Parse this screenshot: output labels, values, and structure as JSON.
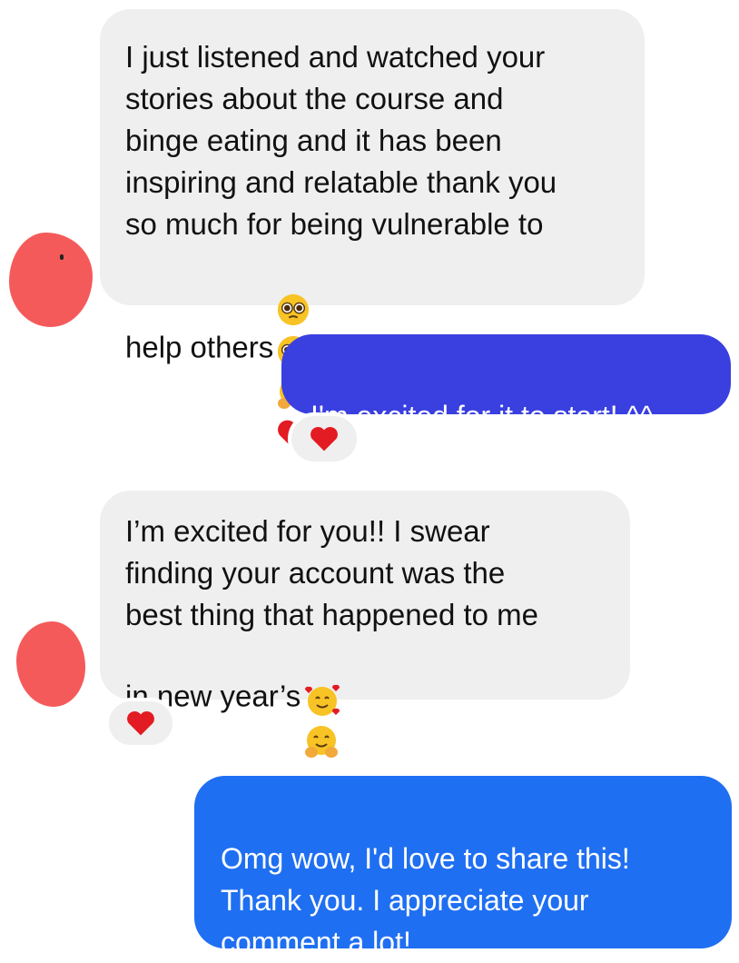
{
  "conversation": {
    "messages": [
      {
        "id": "msg1",
        "direction": "incoming",
        "text": "I just listened and watched your\nstories about the course and\nbinge eating and it has been\ninspiring and relatable thank you\nso much for being vulnerable to\nhelp others",
        "emojis": [
          "pleading-face",
          "pleading-face",
          "hugging-face",
          "red-heart"
        ]
      },
      {
        "id": "msg2",
        "direction": "outgoing",
        "text": "I'm excited for it to start! ^^",
        "reaction": "red-heart"
      },
      {
        "id": "msg3",
        "direction": "incoming",
        "text": "I’m excited for you!! I swear\nfinding your account was the\nbest thing that happened to me\nin new year’s",
        "emojis": [
          "smiling-face-with-hearts",
          "hugging-face"
        ],
        "reaction": "red-heart"
      },
      {
        "id": "msg4",
        "direction": "outgoing",
        "text": "Omg wow, I'd love to share this!\nThank you. I appreciate your\ncomment a lot!"
      }
    ]
  },
  "colors": {
    "incoming_bubble": "#efefef",
    "outgoing_bubble_top": "#3a3fe0",
    "outgoing_bubble_bottom": "#1f6ff2",
    "heart": "#e31b23",
    "redaction": "#f55a5a"
  }
}
